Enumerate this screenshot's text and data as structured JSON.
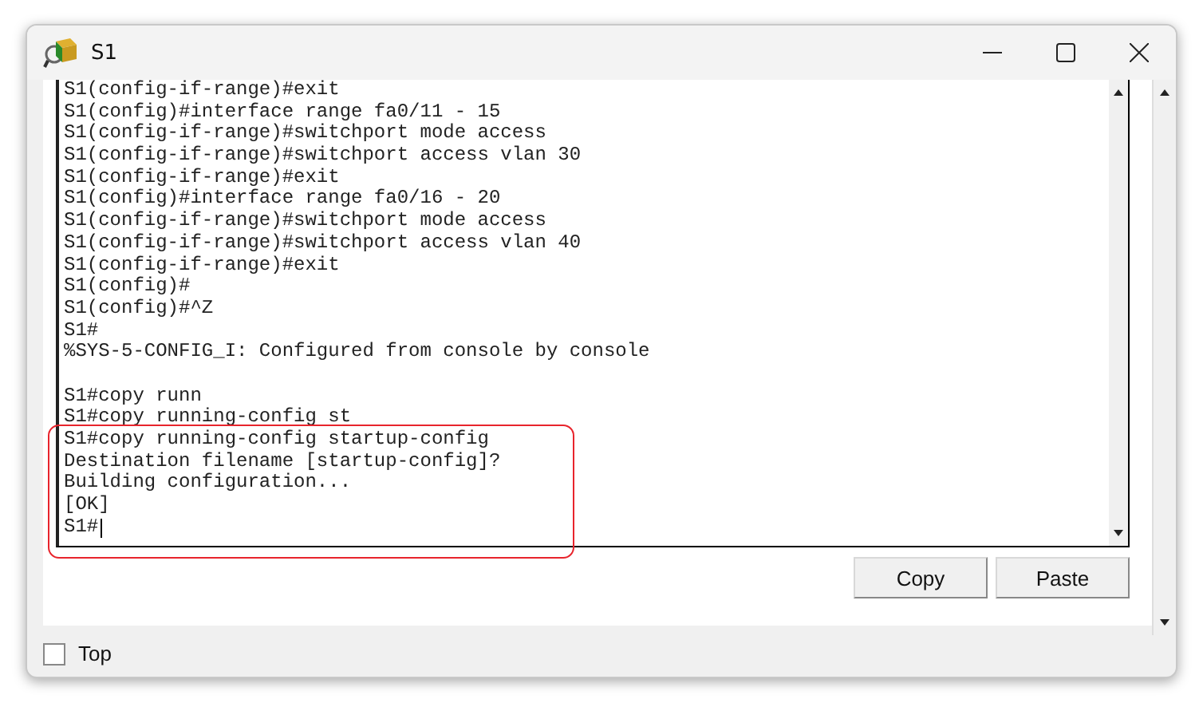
{
  "window": {
    "title": "S1"
  },
  "terminal": {
    "cursor": true,
    "lines": [
      {
        "text": "S1(config-if-range)#exit",
        "highlighted": false
      },
      {
        "text": "S1(config)#interface range fa0/11 - 15",
        "highlighted": false
      },
      {
        "text": "S1(config-if-range)#switchport mode access",
        "highlighted": false
      },
      {
        "text": "S1(config-if-range)#switchport access vlan 30",
        "highlighted": false
      },
      {
        "text": "S1(config-if-range)#exit",
        "highlighted": false
      },
      {
        "text": "S1(config)#interface range fa0/16 - 20",
        "highlighted": false
      },
      {
        "text": "S1(config-if-range)#switchport mode access",
        "highlighted": false
      },
      {
        "text": "S1(config-if-range)#switchport access vlan 40",
        "highlighted": false
      },
      {
        "text": "S1(config-if-range)#exit",
        "highlighted": false
      },
      {
        "text": "S1(config)#",
        "highlighted": false
      },
      {
        "text": "S1(config)#^Z",
        "highlighted": false
      },
      {
        "text": "S1#",
        "highlighted": false
      },
      {
        "text": "%SYS-5-CONFIG_I: Configured from console by console",
        "highlighted": false
      },
      {
        "highlighted": false
      },
      {
        "text": "S1#copy runn",
        "highlighted": false
      },
      {
        "text": "S1#copy running-config st",
        "highlighted": false
      },
      {
        "text": "S1#copy running-config startup-config",
        "highlighted": true
      },
      {
        "text": "Destination filename [startup-config]?",
        "highlighted": true
      },
      {
        "text": "Building configuration...",
        "highlighted": true
      },
      {
        "text": "[OK]",
        "highlighted": true
      },
      {
        "text": "S1#",
        "highlighted": true
      }
    ]
  },
  "buttons": [
    "Copy",
    "Paste"
  ],
  "top_checkbox": {
    "label": "Top",
    "checked": false
  }
}
